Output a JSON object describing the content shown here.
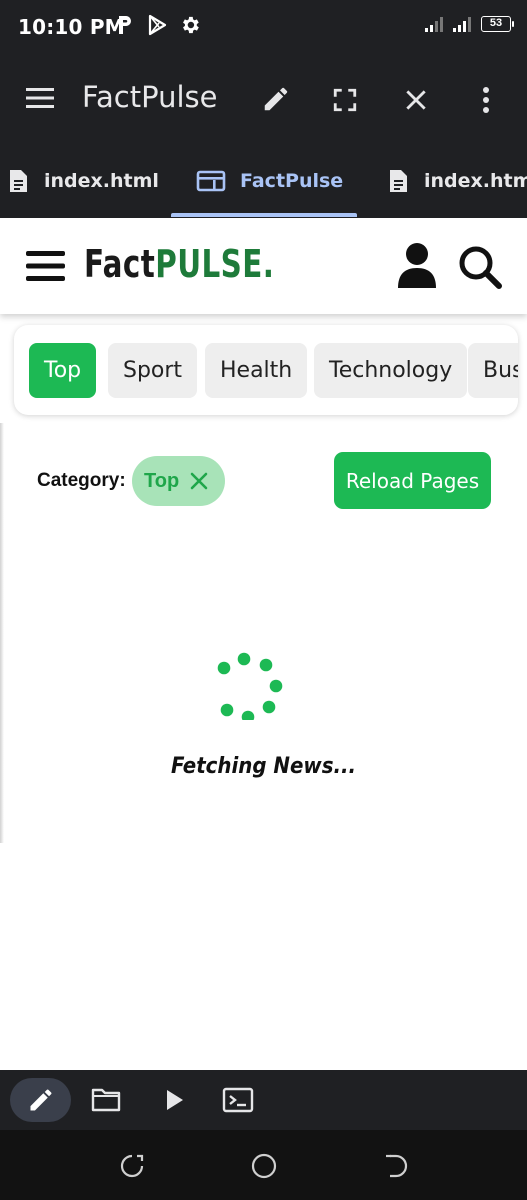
{
  "status_bar": {
    "time": "10:10 PM",
    "icons": [
      "p-icon",
      "play-store-icon",
      "settings-gear-icon"
    ],
    "battery": "53"
  },
  "app_bar": {
    "title": "FactPulse",
    "actions": [
      "edit-pencil-icon",
      "fullscreen-icon",
      "close-icon",
      "more-vert-icon"
    ]
  },
  "tabs": [
    {
      "label": "index.html",
      "icon": "file-document-icon",
      "active": false
    },
    {
      "label": "FactPulse",
      "icon": "browser-window-icon",
      "active": true
    },
    {
      "label": "index.html",
      "icon": "file-document-icon",
      "active": false
    }
  ],
  "site": {
    "logo_part1": "Fact",
    "logo_part2": "PULSE.",
    "categories": [
      "Top",
      "Sport",
      "Health",
      "Technology",
      "Bus"
    ],
    "active_category": "Top",
    "category_label": "Category:",
    "category_pill": "Top",
    "reload_label": "Reload Pages",
    "loading_text": "Fetching News..."
  },
  "colors": {
    "accent_green": "#1db954",
    "logo_green": "#1e7b3a",
    "pill_bg": "#a8e3b8",
    "chrome_dark": "#1f2023",
    "tab_active": "#a9c3f5"
  },
  "toolbar": {
    "items": [
      "edit-icon",
      "folder-icon",
      "run-play-icon",
      "terminal-icon"
    ]
  },
  "nav_bar": {
    "items": [
      "recents-icon",
      "home-icon",
      "back-icon"
    ]
  }
}
